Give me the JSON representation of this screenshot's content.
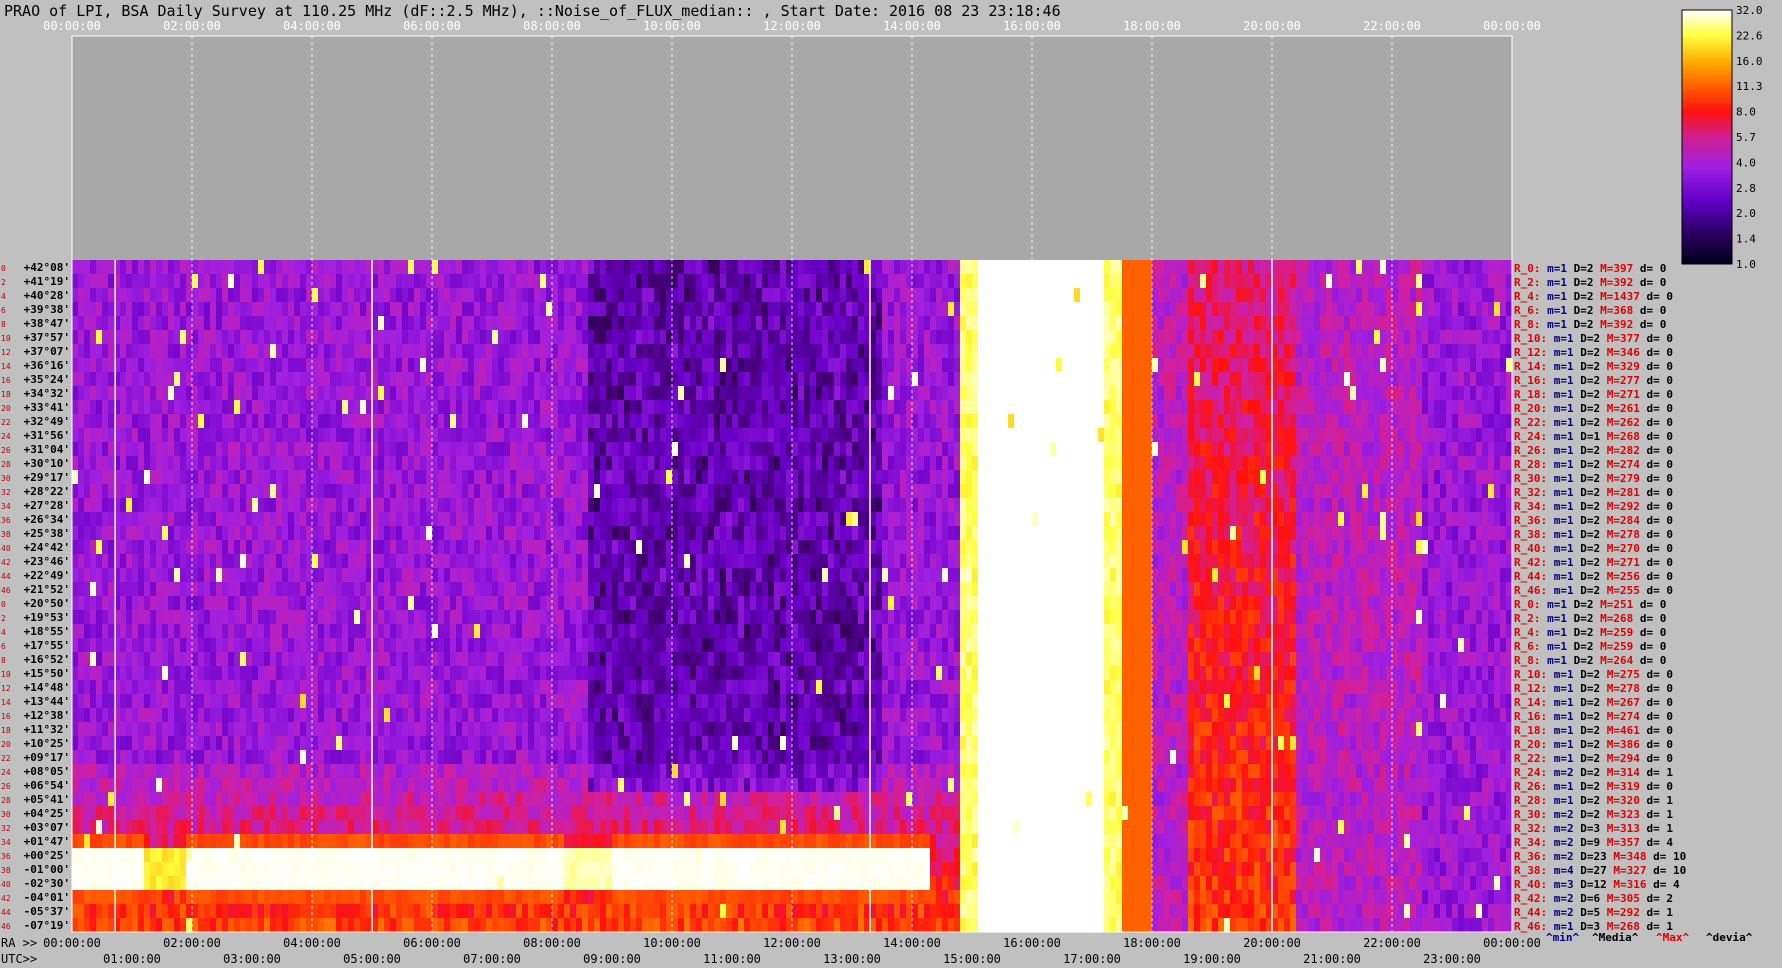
{
  "title": "PRAO of LPI, BSA Daily Survey at 110.25 MHz (dF::2.5 MHz), ::Noise_of_FLUX_median:: , Start Date: 2016 08 23 23:18:46",
  "chart_data": {
    "type": "heatmap",
    "top_axis_ticks": [
      "00:00:00",
      "02:00:00",
      "04:00:00",
      "06:00:00",
      "08:00:00",
      "10:00:00",
      "12:00:00",
      "14:00:00",
      "16:00:00",
      "18:00:00",
      "20:00:00",
      "22:00:00",
      "00:00:00"
    ],
    "bottom_ra_prefix": "RA >>",
    "bottom_ra_ticks": [
      "00:00:00",
      "02:00:00",
      "04:00:00",
      "06:00:00",
      "08:00:00",
      "10:00:00",
      "12:00:00",
      "14:00:00",
      "16:00:00",
      "18:00:00",
      "20:00:00",
      "22:00:00",
      "00:00:00"
    ],
    "bottom_utc_prefix": "UTC>>",
    "bottom_utc_ticks": [
      "01:00:00",
      "03:00:00",
      "05:00:00",
      "07:00:00",
      "09:00:00",
      "11:00:00",
      "13:00:00",
      "15:00:00",
      "17:00:00",
      "19:00:00",
      "21:00:00",
      "23:00:00"
    ],
    "declinations": [
      "+42°08'",
      "+41°19'",
      "+40°28'",
      "+39°38'",
      "+38°47'",
      "+37°57'",
      "+37°07'",
      "+36°16'",
      "+35°24'",
      "+34°32'",
      "+33°41'",
      "+32°49'",
      "+31°56'",
      "+31°04'",
      "+30°10'",
      "+29°17'",
      "+28°22'",
      "+27°28'",
      "+26°34'",
      "+25°38'",
      "+24°42'",
      "+23°46'",
      "+22°49'",
      "+21°52'",
      "+20°50'",
      "+19°53'",
      "+18°55'",
      "+17°55'",
      "+16°52'",
      "+15°50'",
      "+14°48'",
      "+13°44'",
      "+12°38'",
      "+11°32'",
      "+10°25'",
      "+09°17'",
      "+08°05'",
      "+06°54'",
      "+05°41'",
      "+04°25'",
      "+03°07'",
      "+01°47'",
      "+00°25'",
      "-01°00'",
      "-02°30'",
      "-04°01'",
      "-05°37'",
      "-07°19'"
    ],
    "row_indices": [
      "0",
      "2",
      "4",
      "6",
      "8",
      "10",
      "12",
      "14",
      "16",
      "18",
      "20",
      "22",
      "24",
      "26",
      "28",
      "30",
      "32",
      "34",
      "36",
      "38",
      "40",
      "42",
      "44",
      "46",
      "0",
      "2",
      "4",
      "6",
      "8",
      "10",
      "12",
      "14",
      "16",
      "18",
      "20",
      "22",
      "24",
      "26",
      "28",
      "30",
      "32",
      "34",
      "36",
      "38",
      "40",
      "42",
      "44",
      "46"
    ],
    "row_stats": [
      {
        "r": "R_0:",
        "m": "m=1",
        "d": "D=2",
        "M": "M=397",
        "dv": "d= 0"
      },
      {
        "r": "R_2:",
        "m": "m=1",
        "d": "D=2",
        "M": "M=392",
        "dv": "d= 0"
      },
      {
        "r": "R_4:",
        "m": "m=1",
        "d": "D=2",
        "M": "M=1437",
        "dv": "d= 0"
      },
      {
        "r": "R_6:",
        "m": "m=1",
        "d": "D=2",
        "M": "M=368",
        "dv": "d= 0"
      },
      {
        "r": "R_8:",
        "m": "m=1",
        "d": "D=2",
        "M": "M=392",
        "dv": "d= 0"
      },
      {
        "r": "R_10:",
        "m": "m=1",
        "d": "D=2",
        "M": "M=377",
        "dv": "d= 0"
      },
      {
        "r": "R_12:",
        "m": "m=1",
        "d": "D=2",
        "M": "M=346",
        "dv": "d= 0"
      },
      {
        "r": "R_14:",
        "m": "m=1",
        "d": "D=2",
        "M": "M=329",
        "dv": "d= 0"
      },
      {
        "r": "R_16:",
        "m": "m=1",
        "d": "D=2",
        "M": "M=277",
        "dv": "d= 0"
      },
      {
        "r": "R_18:",
        "m": "m=1",
        "d": "D=2",
        "M": "M=271",
        "dv": "d= 0"
      },
      {
        "r": "R_20:",
        "m": "m=1",
        "d": "D=2",
        "M": "M=261",
        "dv": "d= 0"
      },
      {
        "r": "R_22:",
        "m": "m=1",
        "d": "D=2",
        "M": "M=262",
        "dv": "d= 0"
      },
      {
        "r": "R_24:",
        "m": "m=1",
        "d": "D=1",
        "M": "M=268",
        "dv": "d= 0"
      },
      {
        "r": "R_26:",
        "m": "m=1",
        "d": "D=2",
        "M": "M=282",
        "dv": "d= 0"
      },
      {
        "r": "R_28:",
        "m": "m=1",
        "d": "D=2",
        "M": "M=274",
        "dv": "d= 0"
      },
      {
        "r": "R_30:",
        "m": "m=1",
        "d": "D=2",
        "M": "M=279",
        "dv": "d= 0"
      },
      {
        "r": "R_32:",
        "m": "m=1",
        "d": "D=2",
        "M": "M=281",
        "dv": "d= 0"
      },
      {
        "r": "R_34:",
        "m": "m=1",
        "d": "D=2",
        "M": "M=292",
        "dv": "d= 0"
      },
      {
        "r": "R_36:",
        "m": "m=1",
        "d": "D=2",
        "M": "M=284",
        "dv": "d= 0"
      },
      {
        "r": "R_38:",
        "m": "m=1",
        "d": "D=2",
        "M": "M=278",
        "dv": "d= 0"
      },
      {
        "r": "R_40:",
        "m": "m=1",
        "d": "D=2",
        "M": "M=270",
        "dv": "d= 0"
      },
      {
        "r": "R_42:",
        "m": "m=1",
        "d": "D=2",
        "M": "M=271",
        "dv": "d= 0"
      },
      {
        "r": "R_44:",
        "m": "m=1",
        "d": "D=2",
        "M": "M=256",
        "dv": "d= 0"
      },
      {
        "r": "R_46:",
        "m": "m=1",
        "d": "D=2",
        "M": "M=255",
        "dv": "d= 0"
      },
      {
        "r": "R_0:",
        "m": "m=1",
        "d": "D=2",
        "M": "M=251",
        "dv": "d= 0"
      },
      {
        "r": "R_2:",
        "m": "m=1",
        "d": "D=2",
        "M": "M=268",
        "dv": "d= 0"
      },
      {
        "r": "R_4:",
        "m": "m=1",
        "d": "D=2",
        "M": "M=259",
        "dv": "d= 0"
      },
      {
        "r": "R_6:",
        "m": "m=1",
        "d": "D=2",
        "M": "M=259",
        "dv": "d= 0"
      },
      {
        "r": "R_8:",
        "m": "m=1",
        "d": "D=2",
        "M": "M=264",
        "dv": "d= 0"
      },
      {
        "r": "R_10:",
        "m": "m=1",
        "d": "D=2",
        "M": "M=275",
        "dv": "d= 0"
      },
      {
        "r": "R_12:",
        "m": "m=1",
        "d": "D=2",
        "M": "M=278",
        "dv": "d= 0"
      },
      {
        "r": "R_14:",
        "m": "m=1",
        "d": "D=2",
        "M": "M=267",
        "dv": "d= 0"
      },
      {
        "r": "R_16:",
        "m": "m=1",
        "d": "D=2",
        "M": "M=274",
        "dv": "d= 0"
      },
      {
        "r": "R_18:",
        "m": "m=1",
        "d": "D=2",
        "M": "M=461",
        "dv": "d= 0"
      },
      {
        "r": "R_20:",
        "m": "m=1",
        "d": "D=2",
        "M": "M=386",
        "dv": "d= 0"
      },
      {
        "r": "R_22:",
        "m": "m=1",
        "d": "D=2",
        "M": "M=294",
        "dv": "d= 0"
      },
      {
        "r": "R_24:",
        "m": "m=2",
        "d": "D=2",
        "M": "M=314",
        "dv": "d= 1"
      },
      {
        "r": "R_26:",
        "m": "m=1",
        "d": "D=2",
        "M": "M=319",
        "dv": "d= 0"
      },
      {
        "r": "R_28:",
        "m": "m=1",
        "d": "D=2",
        "M": "M=320",
        "dv": "d= 1"
      },
      {
        "r": "R_30:",
        "m": "m=2",
        "d": "D=2",
        "M": "M=323",
        "dv": "d= 1"
      },
      {
        "r": "R_32:",
        "m": "m=2",
        "d": "D=3",
        "M": "M=313",
        "dv": "d= 1"
      },
      {
        "r": "R_34:",
        "m": "m=2",
        "d": "D=9",
        "M": "M=357",
        "dv": "d= 4"
      },
      {
        "r": "R_36:",
        "m": "m=2",
        "d": "D=23",
        "M": "M=348",
        "dv": "d= 10"
      },
      {
        "r": "R_38:",
        "m": "m=4",
        "d": "D=27",
        "M": "M=327",
        "dv": "d= 10"
      },
      {
        "r": "R_40:",
        "m": "m=3",
        "d": "D=12",
        "M": "M=316",
        "dv": "d= 4"
      },
      {
        "r": "R_42:",
        "m": "m=2",
        "d": "D=6",
        "M": "M=305",
        "dv": "d= 2"
      },
      {
        "r": "R_44:",
        "m": "m=2",
        "d": "D=5",
        "M": "M=292",
        "dv": "d= 1"
      },
      {
        "r": "R_46:",
        "m": "m=1",
        "d": "D=3",
        "M": "M=268",
        "dv": "d= 1"
      }
    ],
    "stat_legend": [
      "^min^",
      "^Media^",
      "^Max^",
      "^devia^"
    ],
    "colorbar_ticks": [
      "32.0",
      "22.6",
      "16.0",
      "11.3",
      "8.0",
      "5.7",
      "4.0",
      "2.8",
      "2.0",
      "1.4",
      "1.0"
    ],
    "colormap": [
      "#00001a",
      "#3a0060",
      "#6a00c8",
      "#a020e0",
      "#d020a0",
      "#ff1010",
      "#ff6000",
      "#ffb000",
      "#ffff40",
      "#ffffd0",
      "#ffffff"
    ]
  }
}
